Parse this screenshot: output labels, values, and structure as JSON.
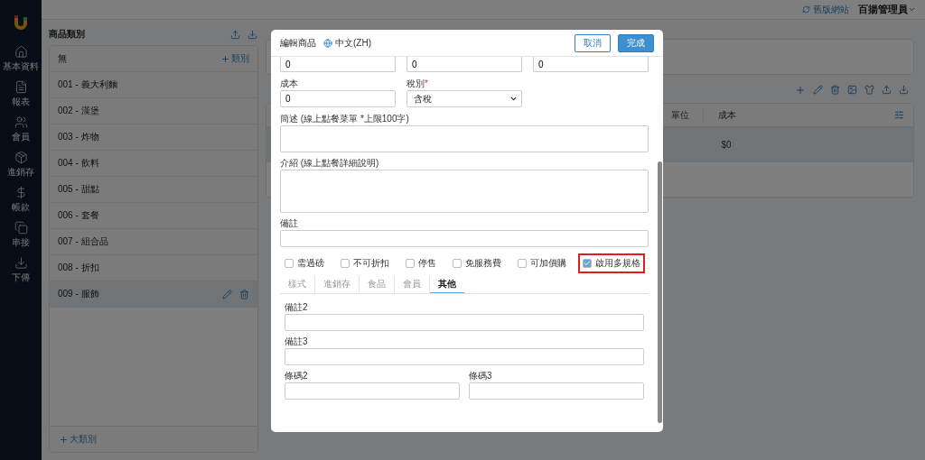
{
  "sidebar": {
    "items": [
      {
        "label": "基本資料"
      },
      {
        "label": "報表"
      },
      {
        "label": "會員"
      },
      {
        "label": "進銷存"
      },
      {
        "label": "帳款"
      },
      {
        "label": "串接"
      },
      {
        "label": "下傳"
      }
    ]
  },
  "topbar": {
    "link": "舊版網站",
    "user": "百揚管理員"
  },
  "category_panel": {
    "title": "商品類別",
    "header_row": "無",
    "add_button": "類別",
    "footer_button": "大類別",
    "items": [
      {
        "label": "001 - 義大利麵",
        "selected": false
      },
      {
        "label": "002 - 漢堡",
        "selected": false
      },
      {
        "label": "003 - 炸物",
        "selected": false
      },
      {
        "label": "004 - 飲料",
        "selected": false
      },
      {
        "label": "005 - 甜點",
        "selected": false
      },
      {
        "label": "006 - 套餐",
        "selected": false
      },
      {
        "label": "007 - 組合品",
        "selected": false
      },
      {
        "label": "008 - 折扣",
        "selected": false
      },
      {
        "label": "009 - 服飾",
        "selected": true
      }
    ]
  },
  "product_table": {
    "columns": [
      "單位",
      "成本"
    ],
    "rows": [
      {
        "cells": [
          "",
          "$0"
        ],
        "selected": true
      }
    ]
  },
  "modal": {
    "title": "編輯商品",
    "language": "中文(ZH)",
    "buttons": [
      {
        "label": "取消",
        "kind": "secondary"
      },
      {
        "label": "完成",
        "kind": "primary"
      }
    ],
    "top_values": [
      "0",
      "0",
      "0"
    ],
    "cost": {
      "label": "成本",
      "value": "0"
    },
    "tax": {
      "label": "稅別",
      "mark": "*",
      "value": "含稅"
    },
    "summary": {
      "label": "簡述 (線上點餐菜單 *上限100字)"
    },
    "intro": {
      "label": "介紹 (線上點餐詳細說明)"
    },
    "note": {
      "label": "備註"
    },
    "checkboxes": [
      {
        "label": "需過磅",
        "checked": false,
        "highlighted": false
      },
      {
        "label": "不可折扣",
        "checked": false,
        "highlighted": false
      },
      {
        "label": "停售",
        "checked": false,
        "highlighted": false
      },
      {
        "label": "免服務費",
        "checked": false,
        "highlighted": false
      },
      {
        "label": "可加價購",
        "checked": false,
        "highlighted": false
      },
      {
        "label": "啟用多規格",
        "checked": true,
        "highlighted": true
      }
    ],
    "tabs": [
      {
        "label": "樣式",
        "selected": false
      },
      {
        "label": "進銷存",
        "selected": false
      },
      {
        "label": "食品",
        "selected": false
      },
      {
        "label": "會員",
        "selected": false
      },
      {
        "label": "其他",
        "selected": true
      }
    ],
    "other_fields": [
      {
        "label": "備註2",
        "kind": "wide"
      },
      {
        "label": "備註3",
        "kind": "wide"
      },
      {
        "label": "條碼2",
        "kind": "half"
      },
      {
        "label": "條碼3",
        "kind": "half"
      }
    ]
  }
}
